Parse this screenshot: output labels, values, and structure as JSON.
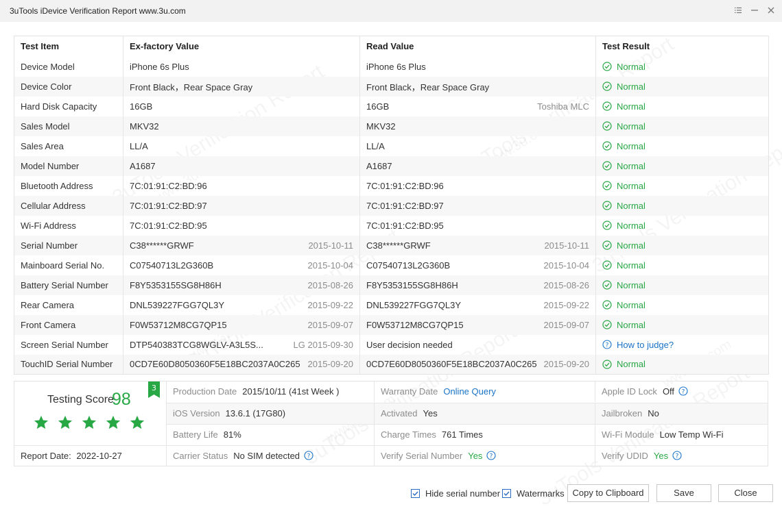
{
  "window": {
    "title": "3uTools iDevice Verification Report www.3u.com"
  },
  "table": {
    "headers": [
      "Test Item",
      "Ex-factory Value",
      "Read Value",
      "Test Result"
    ],
    "rows": [
      {
        "item": "Device Model",
        "ex": "iPhone 6s Plus",
        "ex_date": "",
        "read": "iPhone 6s Plus",
        "read_note": "",
        "result": "Normal",
        "type": "ok"
      },
      {
        "item": "Device Color",
        "ex": "Front Black，Rear Space Gray",
        "ex_date": "",
        "read": "Front Black，Rear Space Gray",
        "read_note": "",
        "result": "Normal",
        "type": "ok"
      },
      {
        "item": "Hard Disk Capacity",
        "ex": "16GB",
        "ex_date": "",
        "read": "16GB",
        "read_note": "Toshiba MLC",
        "result": "Normal",
        "type": "ok"
      },
      {
        "item": "Sales Model",
        "ex": "MKV32",
        "ex_date": "",
        "read": "MKV32",
        "read_note": "",
        "result": "Normal",
        "type": "ok"
      },
      {
        "item": "Sales Area",
        "ex": "LL/A",
        "ex_date": "",
        "read": "LL/A",
        "read_note": "",
        "result": "Normal",
        "type": "ok"
      },
      {
        "item": "Model Number",
        "ex": "A1687",
        "ex_date": "",
        "read": "A1687",
        "read_note": "",
        "result": "Normal",
        "type": "ok"
      },
      {
        "item": "Bluetooth Address",
        "ex": "7C:01:91:C2:BD:96",
        "ex_date": "",
        "read": "7C:01:91:C2:BD:96",
        "read_note": "",
        "result": "Normal",
        "type": "ok"
      },
      {
        "item": "Cellular Address",
        "ex": "7C:01:91:C2:BD:97",
        "ex_date": "",
        "read": "7C:01:91:C2:BD:97",
        "read_note": "",
        "result": "Normal",
        "type": "ok"
      },
      {
        "item": "Wi-Fi Address",
        "ex": "7C:01:91:C2:BD:95",
        "ex_date": "",
        "read": "7C:01:91:C2:BD:95",
        "read_note": "",
        "result": "Normal",
        "type": "ok"
      },
      {
        "item": "Serial Number",
        "ex": "C38******GRWF",
        "ex_date": "2015-10-11",
        "read": "C38******GRWF",
        "read_note": "2015-10-11",
        "result": "Normal",
        "type": "ok"
      },
      {
        "item": "Mainboard Serial No.",
        "ex": "C07540713L2G360B",
        "ex_date": "2015-10-04",
        "read": "C07540713L2G360B",
        "read_note": "2015-10-04",
        "result": "Normal",
        "type": "ok"
      },
      {
        "item": "Battery Serial Number",
        "ex": "F8Y5353155SG8H86H",
        "ex_date": "2015-08-26",
        "read": "F8Y5353155SG8H86H",
        "read_note": "2015-08-26",
        "result": "Normal",
        "type": "ok"
      },
      {
        "item": "Rear Camera",
        "ex": "DNL539227FGG7QL3Y",
        "ex_date": "2015-09-22",
        "read": "DNL539227FGG7QL3Y",
        "read_note": "2015-09-22",
        "result": "Normal",
        "type": "ok"
      },
      {
        "item": "Front Camera",
        "ex": "F0W53712M8CG7QP15",
        "ex_date": "2015-09-07",
        "read": "F0W53712M8CG7QP15",
        "read_note": "2015-09-07",
        "result": "Normal",
        "type": "ok"
      },
      {
        "item": "Screen Serial Number",
        "ex": "DTP540383TCG8WGLV-A3L5S...",
        "ex_date": "LG 2015-09-30",
        "read": "User decision needed",
        "read_note": "",
        "result": "How to judge?",
        "type": "help"
      },
      {
        "item": "TouchID Serial Number",
        "ex": "0CD7E60D8050360F5E18BC2037A0C265",
        "ex_date": "2015-09-20",
        "read": "0CD7E60D8050360F5E18BC2037A0C265",
        "read_note": "2015-09-20",
        "result": "Normal",
        "type": "ok"
      }
    ]
  },
  "score": {
    "label": "Testing Score",
    "value": "98",
    "badge": "3",
    "stars": 5,
    "report_date_label": "Report Date:",
    "report_date": "2022-10-27"
  },
  "info": {
    "production_date": {
      "label": "Production Date",
      "value": "2015/10/11 (41st Week )"
    },
    "warranty_date": {
      "label": "Warranty Date",
      "value": "Online Query"
    },
    "apple_id_lock": {
      "label": "Apple ID Lock",
      "value": "Off"
    },
    "ios_version": {
      "label": "iOS Version",
      "value": "13.6.1 (17G80)"
    },
    "activated": {
      "label": "Activated",
      "value": "Yes"
    },
    "jailbroken": {
      "label": "Jailbroken",
      "value": "No"
    },
    "battery_life": {
      "label": "Battery Life",
      "value": "81%"
    },
    "charge_times": {
      "label": "Charge Times",
      "value": "761 Times"
    },
    "wifi_module": {
      "label": "Wi-Fi Module",
      "value": "Low Temp Wi-Fi"
    },
    "carrier_status": {
      "label": "Carrier Status",
      "value": "No SIM detected"
    },
    "verify_serial": {
      "label": "Verify Serial Number",
      "value": "Yes"
    },
    "verify_udid": {
      "label": "Verify UDID",
      "value": "Yes"
    }
  },
  "footer": {
    "hide_serial_label": "Hide serial number",
    "hide_serial_checked": true,
    "watermarks_label": "Watermarks",
    "watermarks_checked": true,
    "copy_label": "Copy to Clipboard",
    "save_label": "Save",
    "close_label": "Close"
  },
  "watermark": {
    "text": "3uTools Verification Report",
    "url": "www.3u.com"
  },
  "colors": {
    "green": "#28a745",
    "blue": "#1a73c8",
    "border": "#e3e3e3"
  }
}
